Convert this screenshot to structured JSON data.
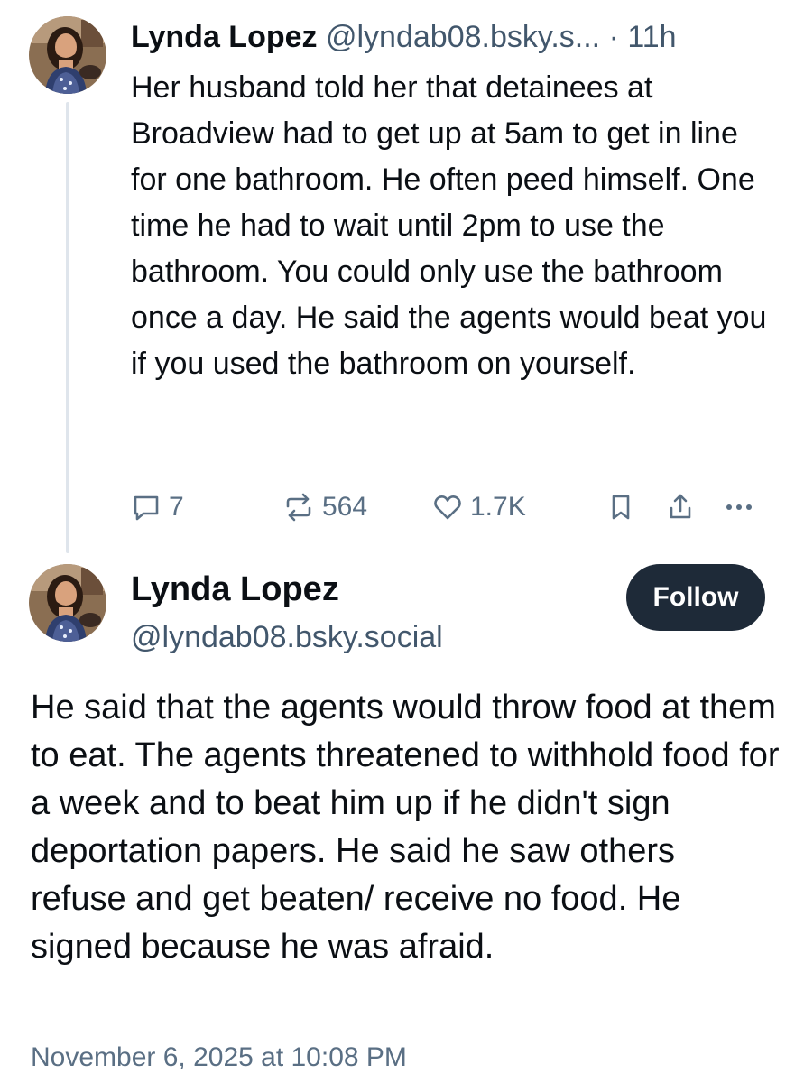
{
  "reply": {
    "author_name": "Lynda Lopez",
    "handle": "@lyndab08.bsky.s...",
    "separator": "·",
    "time": "11h",
    "text": "Her husband told her that detainees at Broadview had to get up at 5am to get in line for one bathroom. He often peed himself. One time he had to wait until 2pm to use the bathroom. You could only use the bathroom once a day. He said the agents would beat you if you used the bathroom on yourself.",
    "actions": {
      "reply_icon": "speech-bubble-icon",
      "reply_count": "7",
      "repost_icon": "repost-arrows-icon",
      "repost_count": "564",
      "like_icon": "heart-icon",
      "like_count": "1.7K",
      "bookmark_icon": "bookmark-icon",
      "share_icon": "share-icon",
      "more_icon": "ellipsis-icon"
    }
  },
  "post": {
    "author_name": "Lynda Lopez",
    "handle": "@lyndab08.bsky.social",
    "follow_label": "Follow",
    "text": "He said that the agents would throw food at them to eat. The agents threatened to withhold food for a week and to beat him up if he didn't sign deportation papers. He said he saw others refuse and get beaten/ receive no food. He signed because he was afraid.",
    "date": "November 6, 2025 at 10:08 PM"
  },
  "colors": {
    "text_primary": "#0b0f14",
    "text_secondary": "#42576c",
    "icon_gray": "#5a6f84",
    "follow_button_bg": "#1e2a38",
    "thread_line": "#dfe5ec"
  }
}
